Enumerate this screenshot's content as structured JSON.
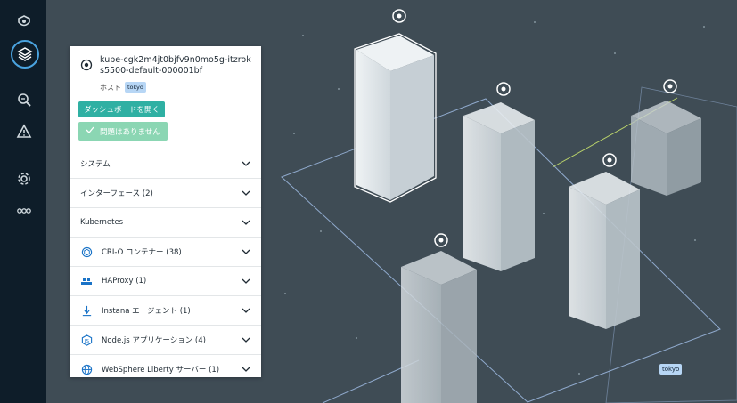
{
  "sidebar": {
    "items": [
      {
        "icon": "eye-logo-icon"
      },
      {
        "icon": "layers-icon"
      },
      {
        "icon": "analyze-icon"
      },
      {
        "icon": "alert-icon"
      },
      {
        "icon": "settings-icon"
      },
      {
        "icon": "more-icon"
      }
    ]
  },
  "panel": {
    "host_name": "kube-cgk2m4jt0bjfv9n0mo5g-itzroks5500-default-000001bf",
    "host_label": "ホスト",
    "zone_tag": "tokyo",
    "dashboard_button": "ダッシュボードを開く",
    "status_button": "問題はありません",
    "sections": [
      {
        "label": "システム",
        "icon": ""
      },
      {
        "label": "インターフェース (2)",
        "icon": ""
      },
      {
        "label": "Kubernetes",
        "icon": ""
      },
      {
        "label": "CRI-O コンテナー (38)",
        "icon": "crio-icon"
      },
      {
        "label": "HAProxy (1)",
        "icon": "haproxy-icon"
      },
      {
        "label": "Instana エージェント (1)",
        "icon": "instana-agent-icon"
      },
      {
        "label": "Node.js アプリケーション (4)",
        "icon": "nodejs-icon"
      },
      {
        "label": "WebSphere Liberty サーバー (1)",
        "icon": "websphere-icon"
      }
    ]
  },
  "map": {
    "zone_label": "tokyo"
  },
  "colors": {
    "background": "#3f4c55",
    "sidebar": "#0e1d29",
    "accent": "#2fb0a3",
    "ok": "#8bd6b3",
    "tag": "#b7d6f5"
  }
}
